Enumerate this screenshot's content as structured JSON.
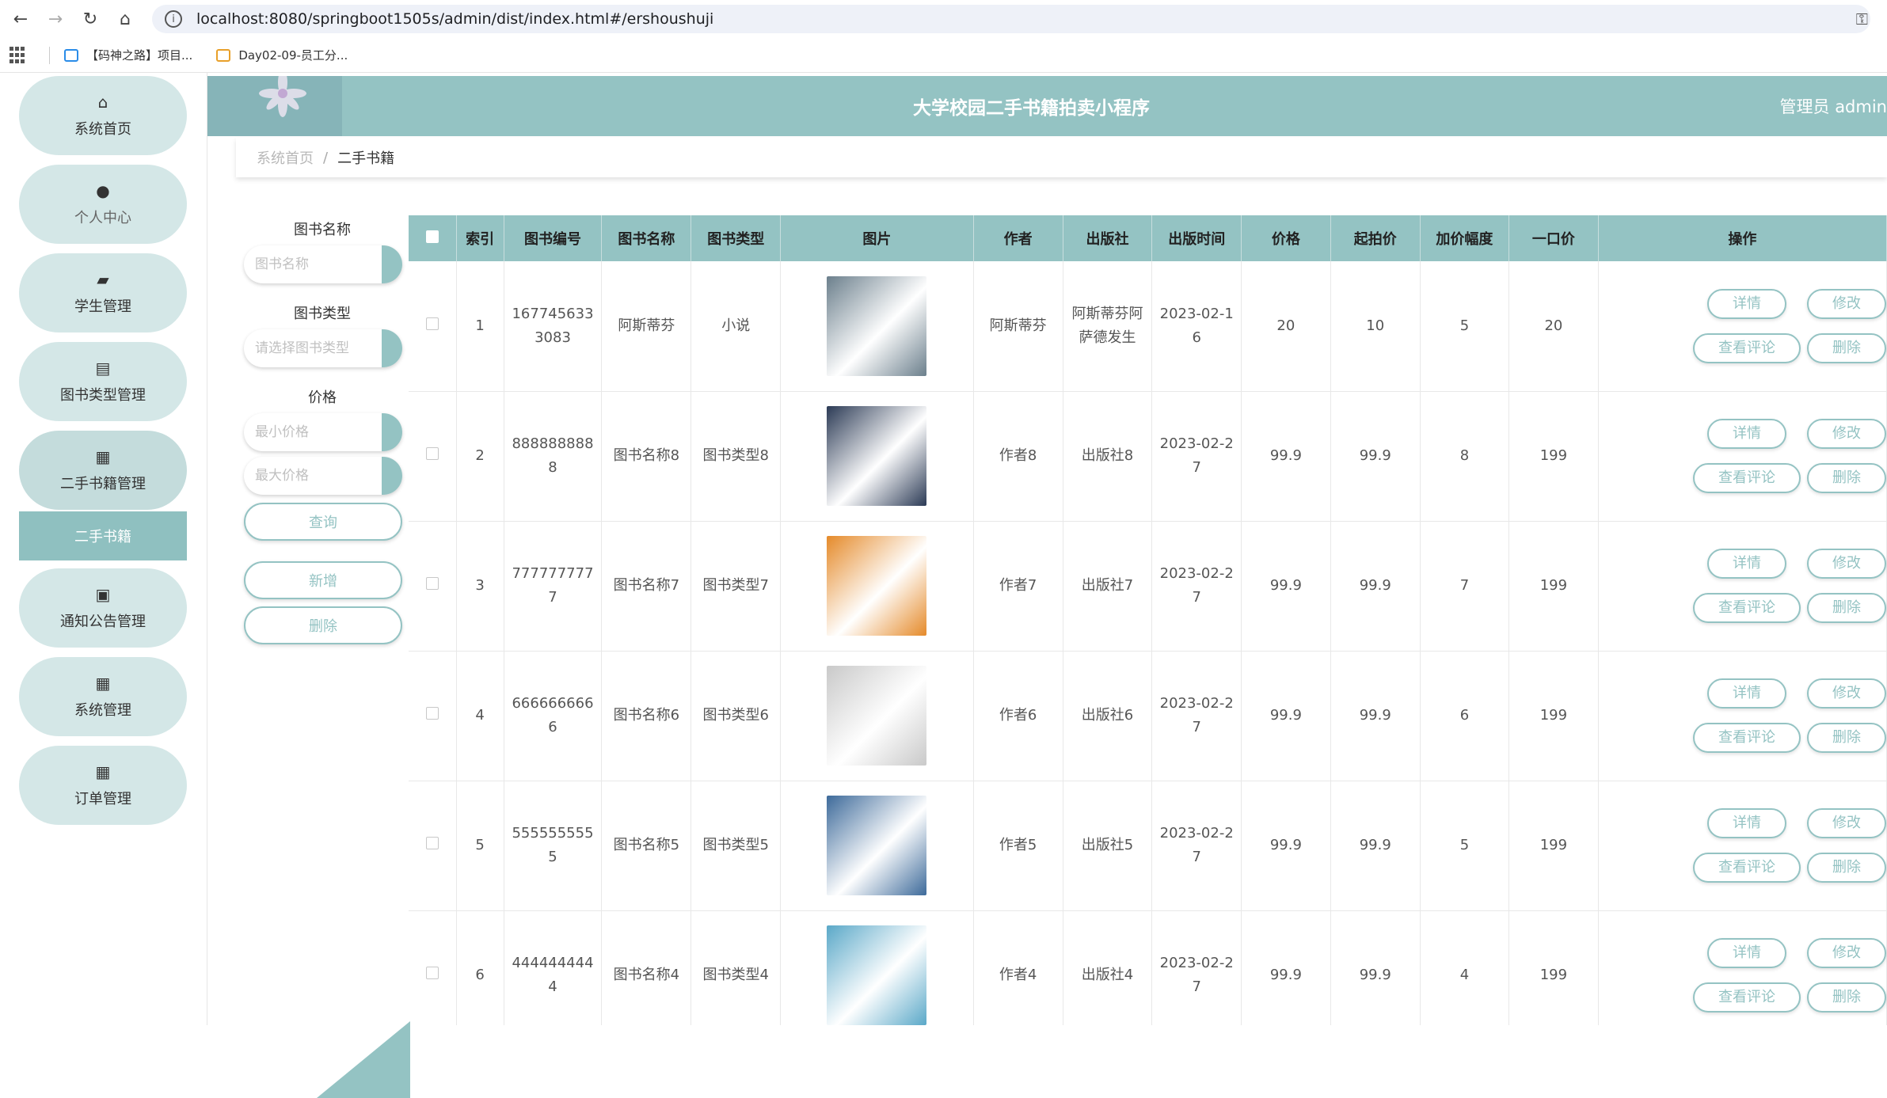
{
  "browser": {
    "url": "localhost:8080/springboot1505s/admin/dist/index.html#/ershoushuji",
    "bookmarks": [
      "【码神之路】项目...",
      "Day02-09-员工分..."
    ]
  },
  "header": {
    "title": "大学校园二手书籍拍卖小程序",
    "user": "管理员 admin"
  },
  "sidebar": {
    "items": [
      {
        "label": "系统首页",
        "icon": "home-icon"
      },
      {
        "label": "个人中心",
        "icon": "user-icon"
      },
      {
        "label": "学生管理",
        "icon": "briefcase-icon"
      },
      {
        "label": "图书类型管理",
        "icon": "clipboard-icon"
      },
      {
        "label": "二手书籍管理",
        "icon": "grid-icon"
      },
      {
        "label": "通知公告管理",
        "icon": "clipboard-x-icon"
      },
      {
        "label": "系统管理",
        "icon": "grid-icon"
      },
      {
        "label": "订单管理",
        "icon": "grid-icon"
      }
    ],
    "sub_active": "二手书籍"
  },
  "breadcrumb": {
    "home": "系统首页",
    "sep": "/",
    "current": "二手书籍"
  },
  "filters": {
    "name_label": "图书名称",
    "name_placeholder": "图书名称",
    "type_label": "图书类型",
    "type_placeholder": "请选择图书类型",
    "price_label": "价格",
    "min_placeholder": "最小价格",
    "max_placeholder": "最大价格",
    "query_btn": "查询",
    "add_btn": "新增",
    "delete_btn": "删除"
  },
  "table": {
    "columns": [
      "索引",
      "图书编号",
      "图书名称",
      "图书类型",
      "图片",
      "作者",
      "出版社",
      "出版时间",
      "价格",
      "起拍价",
      "加价幅度",
      "一口价",
      "操作"
    ],
    "rows": [
      {
        "index": "1",
        "code": "1677456333083",
        "name": "阿斯蒂芬",
        "type": "小说",
        "author": "阿斯蒂芬",
        "publisher": "阿斯蒂芬阿萨德发生",
        "date": "2023-02-16",
        "price": "20",
        "start": "10",
        "step": "5",
        "buyout": "20",
        "img_color": "#6b7f8c"
      },
      {
        "index": "2",
        "code": "8888888888",
        "name": "图书名称8",
        "type": "图书类型8",
        "author": "作者8",
        "publisher": "出版社8",
        "date": "2023-02-27",
        "price": "99.9",
        "start": "99.9",
        "step": "8",
        "buyout": "199",
        "img_color": "#2b3a55"
      },
      {
        "index": "3",
        "code": "7777777777",
        "name": "图书名称7",
        "type": "图书类型7",
        "author": "作者7",
        "publisher": "出版社7",
        "date": "2023-02-27",
        "price": "99.9",
        "start": "99.9",
        "step": "7",
        "buyout": "199",
        "img_color": "#e58a2a"
      },
      {
        "index": "4",
        "code": "6666666666",
        "name": "图书名称6",
        "type": "图书类型6",
        "author": "作者6",
        "publisher": "出版社6",
        "date": "2023-02-27",
        "price": "99.9",
        "start": "99.9",
        "step": "6",
        "buyout": "199",
        "img_color": "#c9c9c9"
      },
      {
        "index": "5",
        "code": "5555555555",
        "name": "图书名称5",
        "type": "图书类型5",
        "author": "作者5",
        "publisher": "出版社5",
        "date": "2023-02-27",
        "price": "99.9",
        "start": "99.9",
        "step": "5",
        "buyout": "199",
        "img_color": "#3d6a9a"
      },
      {
        "index": "6",
        "code": "4444444444",
        "name": "图书名称4",
        "type": "图书类型4",
        "author": "作者4",
        "publisher": "出版社4",
        "date": "2023-02-27",
        "price": "99.9",
        "start": "99.9",
        "step": "4",
        "buyout": "199",
        "img_color": "#5aa8c8"
      }
    ],
    "actions": {
      "detail": "详情",
      "edit": "修改",
      "comments": "查看评论",
      "delete": "删除"
    }
  },
  "colors": {
    "accent": "#94c3c3",
    "sidebar_pill": "#d4e7e7"
  }
}
